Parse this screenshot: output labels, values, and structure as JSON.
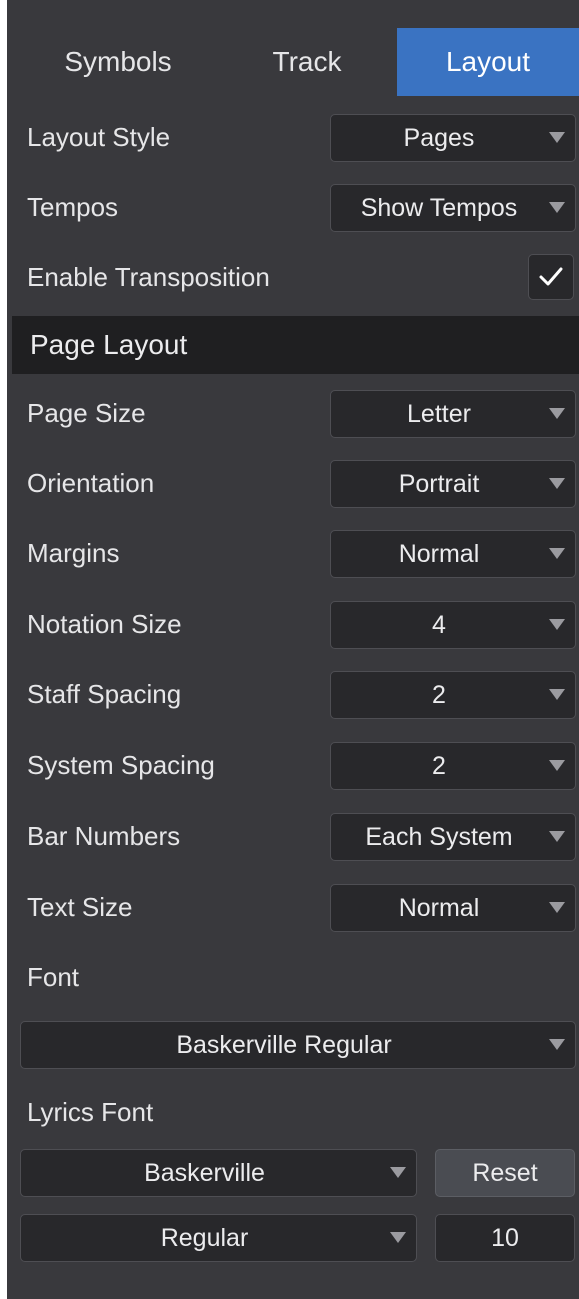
{
  "tabs": {
    "symbols": "Symbols",
    "track": "Track",
    "layout": "Layout",
    "active": "Layout",
    "active_color": "#3a73c2"
  },
  "top_settings": [
    {
      "label": "Layout Style",
      "value": "Pages"
    },
    {
      "label": "Tempos",
      "value": "Show Tempos"
    }
  ],
  "transposition": {
    "label": "Enable Transposition",
    "checked": true
  },
  "page_layout": {
    "title": "Page Layout",
    "rows": [
      {
        "label": "Page Size",
        "value": "Letter"
      },
      {
        "label": "Orientation",
        "value": "Portrait"
      },
      {
        "label": "Margins",
        "value": "Normal"
      },
      {
        "label": "Notation Size",
        "value": "4"
      },
      {
        "label": "Staff Spacing",
        "value": "2"
      },
      {
        "label": "System Spacing",
        "value": "2"
      },
      {
        "label": "Bar Numbers",
        "value": "Each System"
      },
      {
        "label": "Text Size",
        "value": "Normal"
      }
    ]
  },
  "font": {
    "label": "Font",
    "value": "Baskerville Regular"
  },
  "lyrics_font": {
    "label": "Lyrics Font",
    "family": "Baskerville",
    "reset_label": "Reset",
    "style": "Regular",
    "size": "10"
  },
  "icons": {
    "dropdown": "caret-down-icon",
    "check": "checkmark-icon"
  }
}
